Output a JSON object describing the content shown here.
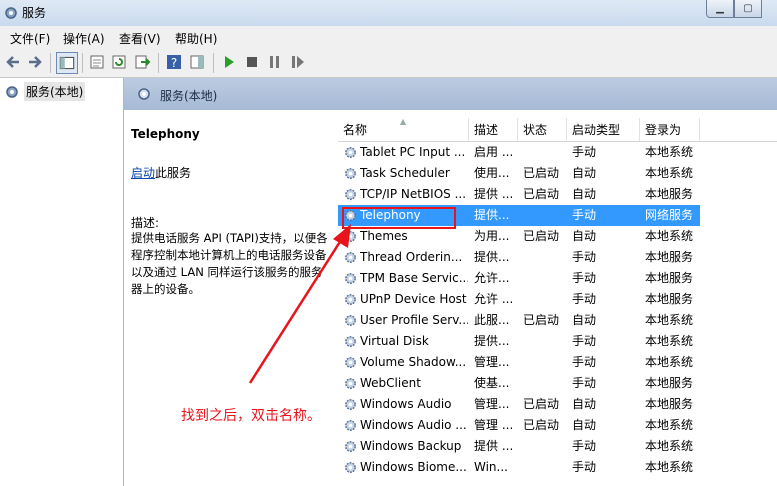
{
  "window": {
    "title": "服务"
  },
  "menubar": {
    "items": [
      "文件(F)",
      "操作(A)",
      "查看(V)",
      "帮助(H)"
    ]
  },
  "tree": {
    "root_label": "服务(本地)"
  },
  "pane": {
    "header": "服务(本地)"
  },
  "description": {
    "service_name": "Telephony",
    "action_link": "启动",
    "action_suffix": "此服务",
    "label": "描述:",
    "body": "提供电话服务 API (TAPI)支持，以便各程序控制本地计算机上的电话服务设备以及通过 LAN 同样运行该服务的服务器上的设备。"
  },
  "list": {
    "columns": [
      "名称",
      "描述",
      "状态",
      "启动类型",
      "登录为"
    ],
    "rows": [
      {
        "name": "Tablet PC Input ...",
        "desc": "启用 ...",
        "status": "",
        "start": "手动",
        "logon": "本地系统"
      },
      {
        "name": "Task Scheduler",
        "desc": "使用...",
        "status": "已启动",
        "start": "自动",
        "logon": "本地系统"
      },
      {
        "name": "TCP/IP NetBIOS ...",
        "desc": "提供 ...",
        "status": "已启动",
        "start": "自动",
        "logon": "本地服务"
      },
      {
        "name": "Telephony",
        "desc": "提供...",
        "status": "",
        "start": "手动",
        "logon": "网络服务",
        "selected": true
      },
      {
        "name": "Themes",
        "desc": "为用...",
        "status": "已启动",
        "start": "自动",
        "logon": "本地系统"
      },
      {
        "name": "Thread Orderin...",
        "desc": "提供...",
        "status": "",
        "start": "手动",
        "logon": "本地服务"
      },
      {
        "name": "TPM Base Servic...",
        "desc": "允许...",
        "status": "",
        "start": "手动",
        "logon": "本地服务"
      },
      {
        "name": "UPnP Device Host",
        "desc": "允许 ...",
        "status": "",
        "start": "手动",
        "logon": "本地服务"
      },
      {
        "name": "User Profile Serv...",
        "desc": "此服...",
        "status": "已启动",
        "start": "自动",
        "logon": "本地系统"
      },
      {
        "name": "Virtual Disk",
        "desc": "提供...",
        "status": "",
        "start": "手动",
        "logon": "本地系统"
      },
      {
        "name": "Volume Shadow...",
        "desc": "管理...",
        "status": "",
        "start": "手动",
        "logon": "本地系统"
      },
      {
        "name": "WebClient",
        "desc": "使基...",
        "status": "",
        "start": "手动",
        "logon": "本地服务"
      },
      {
        "name": "Windows Audio",
        "desc": "管理...",
        "status": "已启动",
        "start": "自动",
        "logon": "本地服务"
      },
      {
        "name": "Windows Audio ...",
        "desc": "管理 ...",
        "status": "已启动",
        "start": "自动",
        "logon": "本地系统"
      },
      {
        "name": "Windows Backup",
        "desc": "提供 ...",
        "status": "",
        "start": "手动",
        "logon": "本地系统"
      },
      {
        "name": "Windows Biome...",
        "desc": "Win...",
        "status": "",
        "start": "手动",
        "logon": "本地系统"
      }
    ]
  },
  "annotation": {
    "text": "找到之后，双击名称。",
    "color": "#e8141b"
  },
  "colors": {
    "selection": "#3399ff",
    "accent": "#e8141b",
    "header": "#a6bad6"
  },
  "icons": [
    "gear-icon",
    "back-icon",
    "forward-icon",
    "play-icon",
    "stop-icon",
    "pause-icon",
    "resume-icon",
    "help-icon",
    "refresh-icon",
    "export-icon"
  ]
}
